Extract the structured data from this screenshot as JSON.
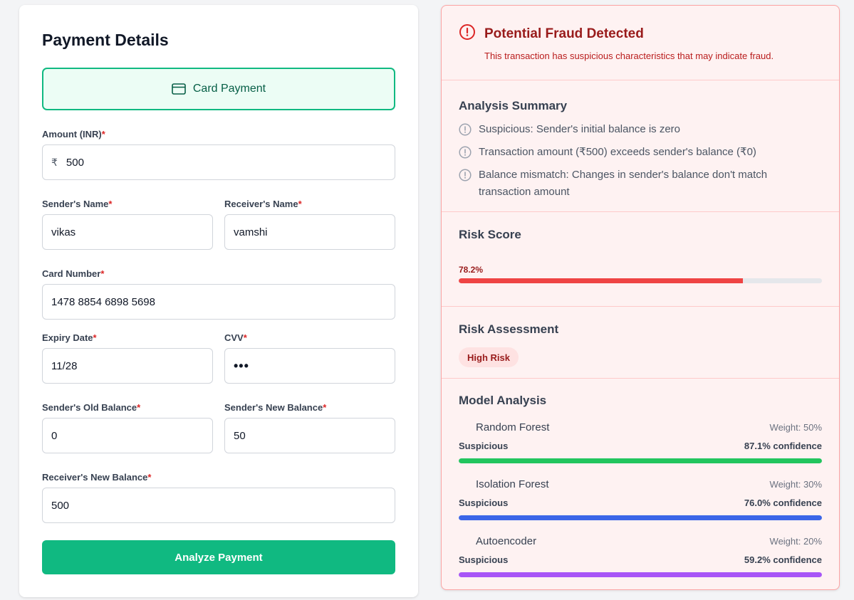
{
  "form": {
    "title": "Payment Details",
    "payment_method": {
      "label": "Card Payment",
      "icon": "credit-card-icon"
    },
    "required_marker": "*",
    "amount": {
      "label": "Amount (INR)",
      "prefix": "₹",
      "value": "500"
    },
    "sender_name": {
      "label": "Sender's Name",
      "value": "vikas"
    },
    "receiver_name": {
      "label": "Receiver's Name",
      "value": "vamshi"
    },
    "card_number": {
      "label": "Card Number",
      "value": "1478 8854 6898 5698"
    },
    "expiry_date": {
      "label": "Expiry Date",
      "value": "11/28"
    },
    "cvv": {
      "label": "CVV",
      "value": "•••"
    },
    "sender_old_balance": {
      "label": "Sender's Old Balance",
      "value": "0"
    },
    "sender_new_balance": {
      "label": "Sender's New Balance",
      "value": "50"
    },
    "receiver_new_balance": {
      "label": "Receiver's New Balance",
      "value": "500"
    },
    "submit_label": "Analyze Payment",
    "accent_color": "#10b981"
  },
  "result": {
    "alert": {
      "icon": "alert-circle-icon",
      "title": "Potential Fraud Detected",
      "description": "This transaction has suspicious characteristics that may indicate fraud."
    },
    "summary": {
      "title": "Analysis Summary",
      "reasons": [
        "Suspicious: Sender's initial balance is zero",
        "Transaction amount (₹500) exceeds sender's balance (₹0)",
        "Balance mismatch: Changes in sender's balance don't match transaction amount"
      ]
    },
    "risk_score": {
      "title": "Risk Score",
      "label": "78.2%",
      "value": 0.782,
      "color": "#ef4444"
    },
    "risk_assessment": {
      "title": "Risk Assessment",
      "badge": "High Risk"
    },
    "models": {
      "title": "Model Analysis",
      "items": [
        {
          "name": "Random Forest",
          "weight": "Weight: 50%",
          "verdict": "Suspicious",
          "confidence": "87.1% confidence",
          "value": 0.871,
          "color": "#22c55e"
        },
        {
          "name": "Isolation Forest",
          "weight": "Weight: 30%",
          "verdict": "Suspicious",
          "confidence": "76.0% confidence",
          "value": 0.76,
          "color": "#3b66e8"
        },
        {
          "name": "Autoencoder",
          "weight": "Weight: 20%",
          "verdict": "Suspicious",
          "confidence": "59.2% confidence",
          "value": 0.592,
          "color": "#a855f7"
        }
      ]
    }
  }
}
